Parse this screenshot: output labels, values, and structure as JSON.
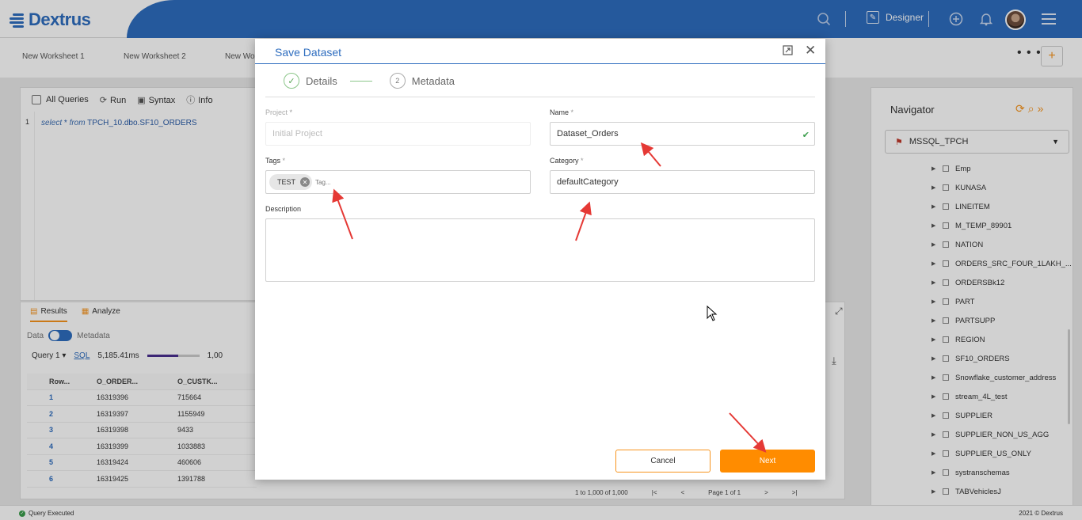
{
  "header": {
    "logo_text": "Dextrus",
    "designer_label": "Designer"
  },
  "worksheets": {
    "tabs": [
      "New Worksheet 1",
      "New Worksheet 2",
      "New Wo"
    ],
    "more_label": "• • •",
    "add_label": "+"
  },
  "editor": {
    "all_queries_label": "All Queries",
    "run_label": "Run",
    "syntax_label": "Syntax",
    "info_label": "Info",
    "line_number": "1",
    "code_keyword1": "select",
    "code_star": " * ",
    "code_keyword2": "from",
    "code_table": " TPCH_10.dbo.SF10_ORDERS"
  },
  "results": {
    "results_tab": "Results",
    "analyze_tab": "Analyze",
    "data_label": "Data",
    "metadata_label": "Metadata",
    "query_select": "Query 1 ▾",
    "sql_link": "SQL",
    "duration": "5,185.41ms",
    "progress_fraction": 0.6,
    "row_count_partial": "1,00",
    "columns": [
      "Row...",
      "O_ORDER...",
      "O_CUSTK..."
    ],
    "rows": [
      [
        "1",
        "16319396",
        "715664"
      ],
      [
        "2",
        "16319397",
        "1155949"
      ],
      [
        "3",
        "16319398",
        "9433"
      ],
      [
        "4",
        "16319399",
        "1033883"
      ],
      [
        "5",
        "16319424",
        "460606"
      ],
      [
        "6",
        "16319425",
        "1391788"
      ]
    ],
    "pagination_range": "1 to 1,000 of 1,000",
    "page_label": "Page",
    "page_number": "1",
    "of_label": "of",
    "page_total": "1"
  },
  "navigator": {
    "title": "Navigator",
    "connection": "MSSQL_TPCH",
    "items": [
      "Emp",
      "KUNASA",
      "LINEITEM",
      "M_TEMP_89901",
      "NATION",
      "ORDERS_SRC_FOUR_1LAKH_...",
      "ORDERSBk12",
      "PART",
      "PARTSUPP",
      "REGION",
      "SF10_ORDERS",
      "Snowflake_customer_address",
      "stream_4L_test",
      "SUPPLIER",
      "SUPPLIER_NON_US_AGG",
      "SUPPLIER_US_ONLY",
      "systranschemas",
      "TABVehiclesJ"
    ]
  },
  "statusbar": {
    "status": "Query Executed",
    "copyright": "2021 © Dextrus"
  },
  "modal": {
    "title": "Save Dataset",
    "steps": [
      {
        "label": "Details",
        "state": "done",
        "marker": "✓"
      },
      {
        "label": "Metadata",
        "state": "pending",
        "marker": "2"
      }
    ],
    "project": {
      "label": "Project",
      "required_mark": "*",
      "value": "Initial Project"
    },
    "name": {
      "label": "Name",
      "required_mark": "*",
      "value": "Dataset_Orders"
    },
    "tags": {
      "label": "Tags",
      "required_mark": "*",
      "chip": "TEST",
      "placeholder": "Tag..."
    },
    "category": {
      "label": "Category",
      "required_mark": "*",
      "value": "defaultCategory"
    },
    "description": {
      "label": "Description"
    },
    "cancel_label": "Cancel",
    "next_label": "Next"
  },
  "colors": {
    "brand_blue": "#2e6dbf",
    "accent_orange": "#ff8c00",
    "annotation_red": "#e53935",
    "success_green": "#3a9d4b"
  }
}
